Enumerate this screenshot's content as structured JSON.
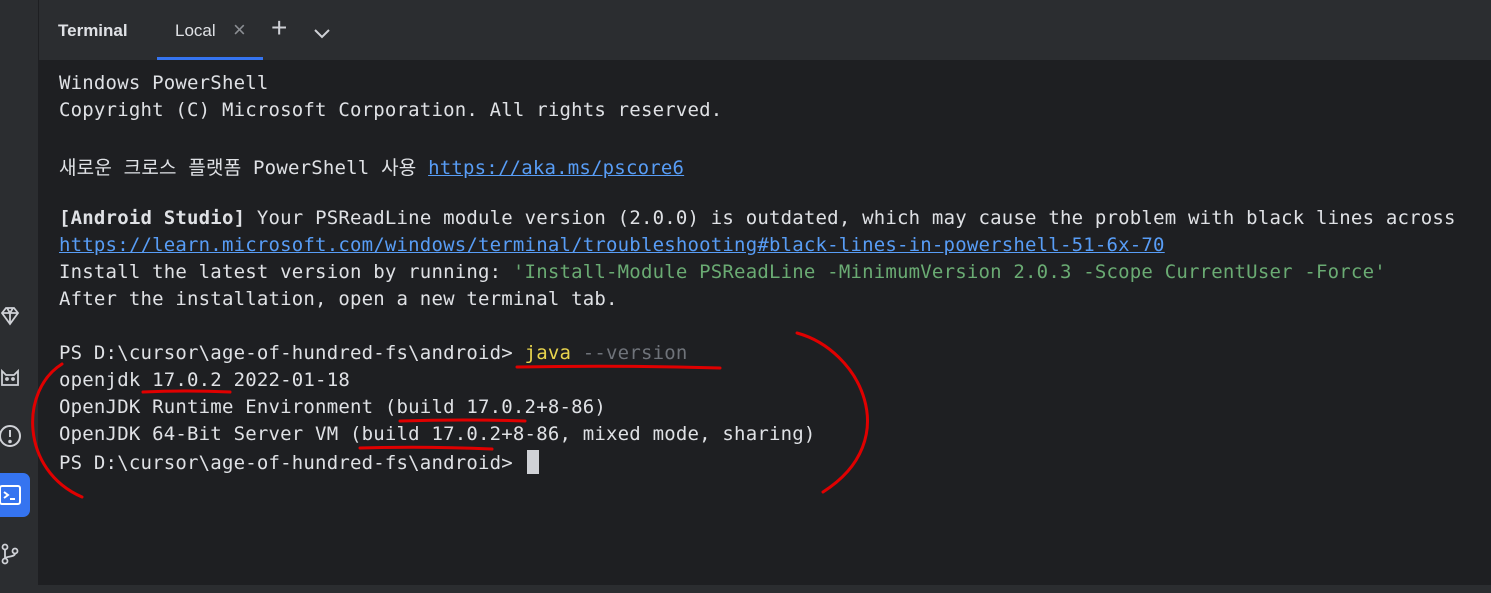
{
  "toolwindow": {
    "title": "Terminal"
  },
  "tabs": [
    {
      "label": "Local",
      "close_icon": "close-icon"
    }
  ],
  "toolbar": {
    "new_tab_icon": "plus-icon",
    "dropdown_icon": "chevron-down-icon"
  },
  "sidebar": {
    "icons": [
      "gem-icon",
      "cat-icon",
      "problems-icon",
      "terminal-icon",
      "git-branch-icon"
    ],
    "active": "terminal-icon"
  },
  "terminal": {
    "header_1": "Windows PowerShell",
    "header_2": "Copyright (C) Microsoft Corporation. All rights reserved.",
    "pscore_prefix": "새로운 크로스 플랫폼 PowerShell 사용 ",
    "pscore_link": "https://aka.ms/pscore6",
    "warn_tag": "[Android Studio]",
    "warn_text": " Your PSReadLine module version (2.0.0) is outdated, which may cause the problem with black lines across",
    "warn_link": "https://learn.microsoft.com/windows/terminal/troubleshooting#black-lines-in-powershell-51-6x-70",
    "install_prefix": "Install the latest version by running: ",
    "install_cmd": "'Install-Module PSReadLine -MinimumVersion 2.0.3 -Scope CurrentUser -Force'",
    "after_install": "After the installation, open a new terminal tab.",
    "prompt_1": "PS D:\\cursor\\age-of-hundred-fs\\android> ",
    "command": "java",
    "command_arg": " --version",
    "out_1": "openjdk 17.0.2 2022-01-18",
    "out_2": "OpenJDK Runtime Environment (build 17.0.2+8-86)",
    "out_3": "OpenJDK 64-Bit Server VM (build 17.0.2+8-86, mixed mode, sharing)",
    "prompt_2": "PS D:\\cursor\\age-of-hundred-fs\\android> "
  },
  "colors": {
    "background": "#1e1f22",
    "panel": "#2b2d30",
    "accent": "#3574f0",
    "link": "#589df6",
    "string": "#6aab73",
    "command": "#e8d44d",
    "annotation": "#e00000"
  }
}
